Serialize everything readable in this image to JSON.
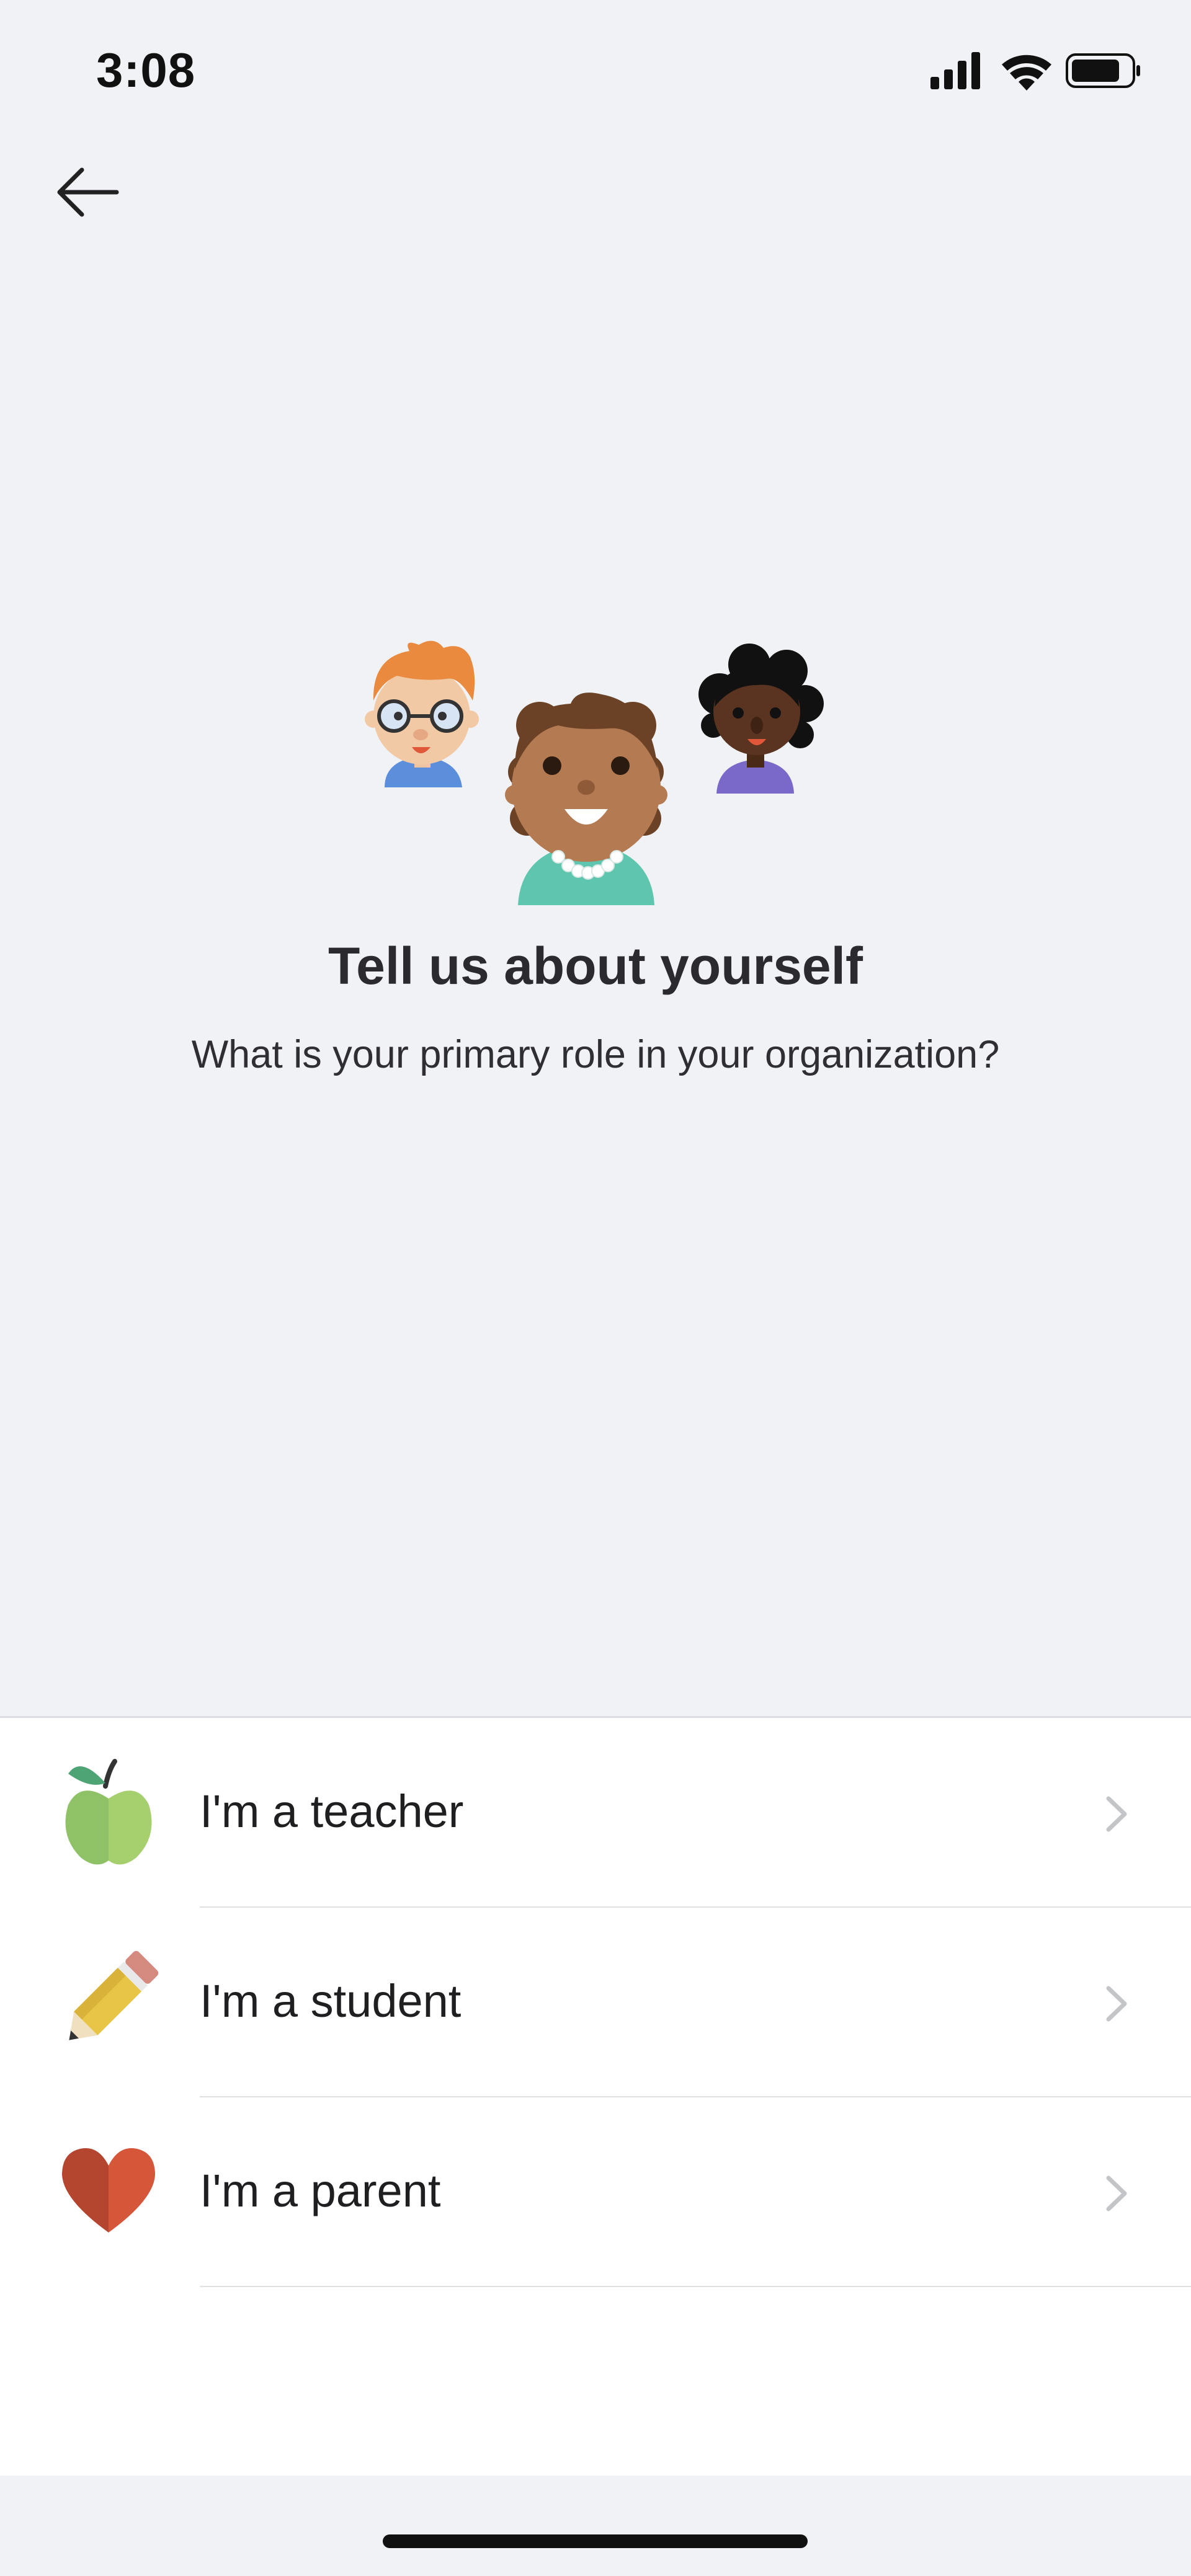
{
  "status_bar": {
    "time": "3:08",
    "icons": [
      "signal-icon",
      "wifi-icon",
      "battery-icon"
    ]
  },
  "nav": {
    "back_icon": "arrow-left-icon"
  },
  "hero": {
    "illustration": "three-people-avatars"
  },
  "header": {
    "title": "Tell us about yourself",
    "subtitle": "What is your primary role in your organization?"
  },
  "options": [
    {
      "label": "I'm a teacher",
      "icon": "apple-icon"
    },
    {
      "label": "I'm a student",
      "icon": "pencil-icon"
    },
    {
      "label": "I'm a parent",
      "icon": "heart-icon"
    }
  ],
  "colors": {
    "background": "#f1f2f5",
    "panel": "#ffffff",
    "chevron": "#c4c5c9"
  }
}
